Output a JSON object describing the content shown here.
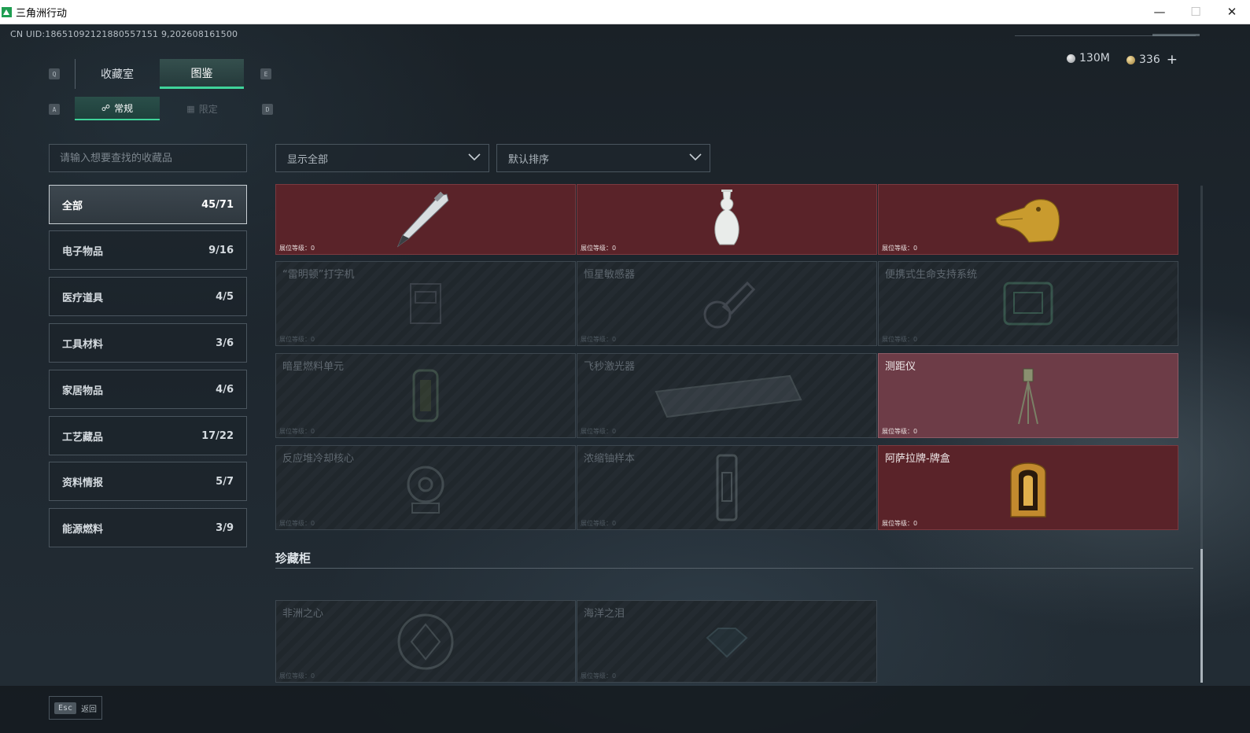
{
  "window": {
    "title": "三角洲行动",
    "minimize": "—",
    "maximize": "☐",
    "close": "✕"
  },
  "header": {
    "uid": "CN UID:18651092121880557151 9,202608161500",
    "currency_silver": "130M",
    "currency_gold": "336",
    "add_label": "+"
  },
  "keys": {
    "prev_tab": "Q",
    "next_tab": "E",
    "prev_sub": "A",
    "next_sub": "D"
  },
  "tabs": {
    "collection_room": "收藏室",
    "atlas": "图鉴"
  },
  "subtabs": {
    "regular": "常规",
    "limited": "限定"
  },
  "search": {
    "placeholder": "请输入想要查找的收藏品"
  },
  "filters": {
    "show": "显示全部",
    "sort": "默认排序"
  },
  "categories": [
    {
      "label": "全部",
      "count": "45/71"
    },
    {
      "label": "电子物品",
      "count": "9/16"
    },
    {
      "label": "医疗道具",
      "count": "4/5"
    },
    {
      "label": "工具材料",
      "count": "3/6"
    },
    {
      "label": "家居物品",
      "count": "4/6"
    },
    {
      "label": "工艺藏品",
      "count": "17/22"
    },
    {
      "label": "资料情报",
      "count": "5/7"
    },
    {
      "label": "能源燃料",
      "count": "3/9"
    }
  ],
  "level_label": "展位等级：0",
  "items": [
    {
      "name": "",
      "owned": true,
      "icon": "pen-icon"
    },
    {
      "name": "",
      "owned": true,
      "icon": "porcelain-vase-icon"
    },
    {
      "name": "",
      "owned": true,
      "icon": "golden-crocodile-icon"
    },
    {
      "name": "“雷明顿”打字机",
      "owned": false,
      "icon": "typewriter-icon"
    },
    {
      "name": "恒星敏感器",
      "owned": false,
      "icon": "star-sensor-icon"
    },
    {
      "name": "便携式生命支持系统",
      "owned": false,
      "icon": "life-support-icon"
    },
    {
      "name": "暗星燃料单元",
      "owned": false,
      "icon": "fuel-cell-icon"
    },
    {
      "name": "飞秒激光器",
      "owned": false,
      "icon": "laser-icon"
    },
    {
      "name": "测距仪",
      "owned": true,
      "icon": "rangefinder-icon"
    },
    {
      "name": "反应堆冷却核心",
      "owned": false,
      "icon": "reactor-core-icon"
    },
    {
      "name": "浓缩铀样本",
      "owned": false,
      "icon": "uranium-sample-icon"
    },
    {
      "name": "阿萨拉牌-牌盒",
      "owned": true,
      "icon": "card-box-icon"
    }
  ],
  "vault": {
    "title": "珍藏柜",
    "items": [
      {
        "name": "非洲之心",
        "owned": false,
        "icon": "diamond-icon"
      },
      {
        "name": "海洋之泪",
        "owned": false,
        "icon": "gem-icon"
      }
    ]
  },
  "footer": {
    "esc_key": "Esc",
    "back_label": "返回"
  },
  "colors": {
    "accent": "#3fd39a",
    "owned_card": "#5a2329",
    "highlight_card": "#6d3c47"
  }
}
